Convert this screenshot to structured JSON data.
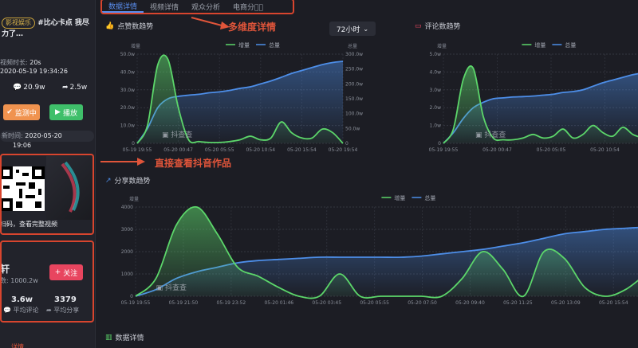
{
  "tabs": [
    "数据详情",
    "视频详情",
    "观众分析",
    "电商分析"
  ],
  "annotations": {
    "multi_dim": "多维度详情",
    "view_works": "直接查看抖音作品"
  },
  "left": {
    "tag": "影视娱乐",
    "title_line1": "#比心卡点 我尽",
    "title_line2": "力了…",
    "duration_label": "视频时长: ",
    "duration": "20s",
    "publish_time": "2020-05-19 19:34:26",
    "comments": "20.9w",
    "shares": "2.5w",
    "monitor_btn": "监测中",
    "play_btn": "播放",
    "update_label": "新时间: ",
    "update_time": "2020-05-20",
    "update_time2": "19:06",
    "qr_caption": "扫码，查看完整视频",
    "author_initial": "轩",
    "fans": "数: 1000.2w",
    "follow_btn": "关注",
    "avg_comment_val": "3.6w",
    "avg_comment_label": "平均评论",
    "avg_share_val": "3379",
    "avg_share_label": "平均分享",
    "bottom_red": "详情"
  },
  "section_bottom": "数据详情",
  "dropdown": "72小时",
  "chart_data": [
    {
      "type": "area",
      "title": "点赞数趋势",
      "legend": [
        "增量",
        "总量"
      ],
      "y_left_label": "增量",
      "y_right_label": "总量",
      "y_left_ticks": [
        "0",
        "10.0w",
        "20.0w",
        "30.0w",
        "40.0w",
        "50.0w"
      ],
      "y_right_ticks": [
        "0",
        "50.0w",
        "100.0w",
        "150.0w",
        "200.0w",
        "250.0w",
        "300.0w"
      ],
      "x_ticks": [
        "05-19 19:55",
        "05-20 00:47",
        "05-20 05:55",
        "05-20 10:54",
        "05-20 15:54",
        "05-20 19:54"
      ],
      "x": [
        0,
        0.05,
        0.1,
        0.15,
        0.2,
        0.25,
        0.3,
        0.35,
        0.4,
        0.45,
        0.5,
        0.55,
        0.6,
        0.65,
        0.7,
        0.75,
        0.8,
        0.85,
        0.9,
        0.95,
        1
      ],
      "increment": [
        0,
        10,
        44,
        47,
        20,
        2,
        1,
        0.5,
        0.5,
        1,
        2,
        4,
        2,
        3,
        12,
        6,
        3,
        3,
        8,
        6,
        0
      ],
      "total": [
        0,
        50,
        120,
        150,
        158,
        162,
        165,
        170,
        173,
        178,
        185,
        190,
        200,
        210,
        222,
        235,
        245,
        255,
        265,
        272,
        276
      ],
      "watermark": "抖查查"
    },
    {
      "type": "area",
      "title": "评论数趋势",
      "legend": [
        "增量",
        "总量"
      ],
      "y_left_label": "增量",
      "y_left_ticks": [
        "0",
        "1.0w",
        "2.0w",
        "3.0w",
        "4.0w",
        "5.0w"
      ],
      "x_ticks": [
        "05-19 19:55",
        "05-20 00:47",
        "05-20 05:05",
        "05-20 10:54",
        "05-20 15:"
      ],
      "x": [
        0,
        0.05,
        0.1,
        0.15,
        0.2,
        0.25,
        0.3,
        0.35,
        0.4,
        0.45,
        0.5,
        0.55,
        0.6,
        0.65,
        0.7,
        0.75,
        0.8,
        0.85,
        0.9,
        0.95,
        1
      ],
      "increment": [
        0,
        0.8,
        3.6,
        4.2,
        1.5,
        0.3,
        0.2,
        0.2,
        0.3,
        0.5,
        0.3,
        0.4,
        0.8,
        0.3,
        0.5,
        1.0,
        0.6,
        0.4,
        0.9,
        0.5,
        0.3
      ],
      "total": [
        0,
        0.6,
        1.4,
        2.0,
        2.3,
        2.5,
        2.55,
        2.6,
        2.62,
        2.65,
        2.7,
        2.75,
        2.85,
        2.9,
        3.0,
        3.2,
        3.4,
        3.55,
        3.7,
        3.85,
        3.95
      ],
      "watermark": "抖查查"
    },
    {
      "type": "area",
      "title": "分享数趋势",
      "legend": [
        "增量",
        "总量"
      ],
      "y_left_label": "增量",
      "y_left_ticks": [
        "0",
        "1000",
        "2000",
        "3000",
        "4000"
      ],
      "x_ticks": [
        "05-19 19:55",
        "05-19 21:50",
        "05-19 23:52",
        "05-20 01:46",
        "05-20 03:45",
        "05-20 05:55",
        "05-20 07:50",
        "05-20 09:40",
        "05-20 11:25",
        "05-20 13:09",
        "05-20 15:54",
        "05-20 17:5"
      ],
      "x": [
        0,
        0.04,
        0.08,
        0.12,
        0.16,
        0.2,
        0.24,
        0.28,
        0.32,
        0.36,
        0.4,
        0.44,
        0.48,
        0.52,
        0.56,
        0.6,
        0.64,
        0.68,
        0.72,
        0.76,
        0.8,
        0.84,
        0.88,
        0.92,
        0.96,
        1
      ],
      "increment": [
        0,
        800,
        3200,
        4000,
        2800,
        1300,
        900,
        400,
        0,
        0,
        1000,
        0,
        0,
        0,
        0,
        0,
        800,
        2000,
        1200,
        0,
        2000,
        1700,
        400,
        0,
        300,
        1000
      ],
      "total": [
        0,
        300,
        800,
        1100,
        1300,
        1500,
        1600,
        1650,
        1700,
        1750,
        1750,
        1750,
        1750,
        1750,
        1800,
        1900,
        2000,
        2100,
        2250,
        2400,
        2600,
        2800,
        2900,
        3000,
        3050,
        3100
      ],
      "watermark": "抖查查"
    }
  ],
  "colors": {
    "green": "#5cd66a",
    "blue": "#4d8ee8",
    "accent_red": "#d8452e",
    "monitor": "#f0934f",
    "play": "#3fbf6a",
    "follow": "#e8455f"
  }
}
